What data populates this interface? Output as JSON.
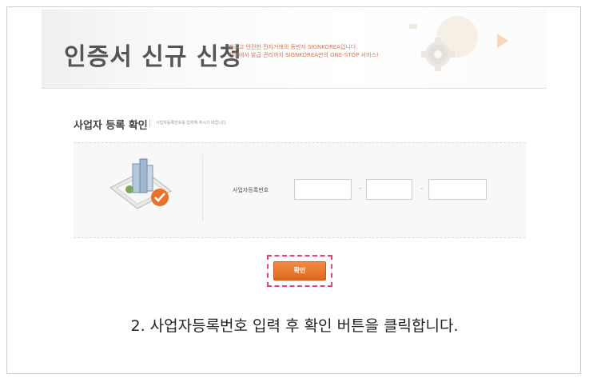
{
  "header": {
    "title": "인증서 신규 신청",
    "subtitle_line1": "빠르고 안전한 전자거래의 동반자 SIGNKOREA입니다.",
    "subtitle_line2": "신청에서 발급 관리까지 SIGNKOREA만의 ONE-STOP 서비스!"
  },
  "section": {
    "title": "사업자 등록 확인",
    "help": "사업자등록번호를 입력해 주시기 바랍니다."
  },
  "form": {
    "label": "사업자등록번호",
    "separator": "-",
    "fields": [
      {
        "value": "",
        "placeholder": ""
      },
      {
        "value": "",
        "placeholder": ""
      },
      {
        "value": "",
        "placeholder": ""
      }
    ]
  },
  "actions": {
    "confirm_label": "확인"
  },
  "caption": "2. 사업자등록번호 입력 후 확인 버튼을 클릭합니다.",
  "colors": {
    "accent": "#e8722a",
    "highlight": "#e8427a",
    "hero_text": "#c87a5a"
  },
  "icons": [
    "building-document-icon",
    "checkmark-icon",
    "gear-icon",
    "play-arrow-icon"
  ]
}
